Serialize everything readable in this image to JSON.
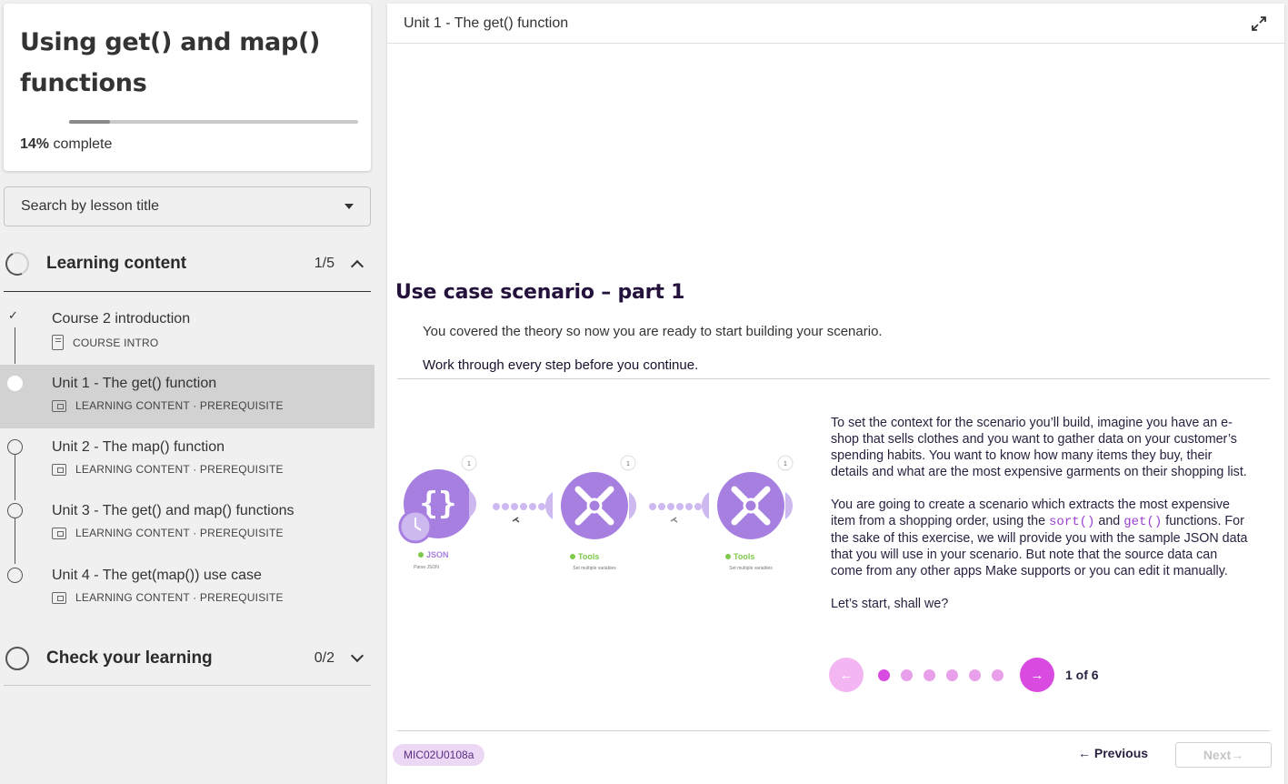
{
  "course": {
    "title": "Using get() and map() functions",
    "progress_percent": 14,
    "progress_value": "14%",
    "progress_suffix": " complete"
  },
  "search": {
    "label": "Search by lesson title"
  },
  "sections": [
    {
      "title": "Learning content",
      "count": "1/5",
      "expanded": true,
      "lessons": [
        {
          "title": "Course 2 introduction",
          "meta": "COURSE INTRO",
          "icon": "document-icon",
          "status": "complete"
        },
        {
          "title": "Unit 1 - The get() function",
          "meta": "LEARNING CONTENT · PREREQUISITE",
          "icon": "slides-icon",
          "status": "current"
        },
        {
          "title": "Unit 2 - The map() function",
          "meta": "LEARNING CONTENT · PREREQUISITE",
          "icon": "slides-icon",
          "status": "todo"
        },
        {
          "title": "Unit 3 - The get() and map() functions",
          "meta": "LEARNING CONTENT · PREREQUISITE",
          "icon": "slides-icon",
          "status": "todo"
        },
        {
          "title": "Unit 4 - The get(map()) use case",
          "meta": "LEARNING CONTENT · PREREQUISITE",
          "icon": "slides-icon",
          "status": "todo"
        }
      ]
    },
    {
      "title": "Check your learning",
      "count": "0/2",
      "expanded": false
    }
  ],
  "main": {
    "header_title": "Unit 1 - The get() function",
    "scenario_title": "Use case scenario – part 1",
    "intro": "You covered the theory so now you are ready to start building your scenario.",
    "instruction": "Work through every step before you continue.",
    "paragraph1": "To set the context for the scenario you’ll build, imagine you have an e-shop that sells clothes and you want to gather data on your customer’s spending habits. You want to know how many items they buy, their details and what are the most expensive garments on their shopping list.",
    "paragraph2_a": "You are going to create a scenario which extracts the most expensive item from a shopping order, using the ",
    "paragraph2_code1": "sort()",
    "paragraph2_b": " and ",
    "paragraph2_code2": "get()",
    "paragraph2_c": " functions. For the sake of this exercise, we will provide you with the sample JSON data that you will use in your scenario. But note that the source data can come from any other apps Make supports or you can edit it manually.",
    "paragraph3": "Let’s start, shall we?",
    "carousel": {
      "current": 1,
      "total": 6,
      "label": "1 of 6"
    },
    "diagram": {
      "modules": [
        {
          "name": "JSON",
          "subtitle": "Parse JSON",
          "badge": "1"
        },
        {
          "name": "Tools",
          "subtitle": "Set multiple variables",
          "badge": "1"
        },
        {
          "name": "Tools",
          "subtitle": "Set multiple variables",
          "badge": "1"
        }
      ]
    },
    "lesson_code": "MIC02U0108a",
    "nav": {
      "previous": "Previous",
      "next": "Next"
    }
  },
  "colors": {
    "accent": "#d94be0",
    "accent_light": "#f3b6f3",
    "module_purple": "#a77fe0",
    "tools_green": "#7ec84b",
    "title_dark": "#24123d"
  }
}
